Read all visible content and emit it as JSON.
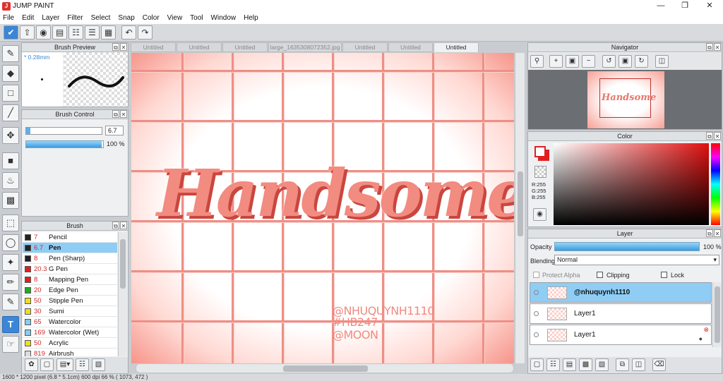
{
  "window": {
    "title": "JUMP PAINT",
    "logo": "jump-paint-logo"
  },
  "menu": [
    "File",
    "Edit",
    "Layer",
    "Filter",
    "Select",
    "Snap",
    "Color",
    "View",
    "Tool",
    "Window",
    "Help"
  ],
  "tabs": [
    "Untitled",
    "Untitled",
    "Untitled",
    "large_1635308072352.jpg",
    "Untitled",
    "Untitled",
    "Untitled"
  ],
  "brush_preview": {
    "title": "Brush Preview",
    "size": "* 0.28mm"
  },
  "brush_control": {
    "title": "Brush Control",
    "size_value": "6.7",
    "opacity_value": "100 %",
    "opacity_level": 1.0,
    "size_level": 0.06
  },
  "brush_panel": {
    "title": "Brush",
    "items": [
      {
        "size": "7",
        "name": "Pencil",
        "color": "#222222"
      },
      {
        "size": "6.7",
        "name": "Pen",
        "color": "#222222",
        "selected": true
      },
      {
        "size": "8",
        "name": "Pen (Sharp)",
        "color": "#222222"
      },
      {
        "size": "20.3",
        "name": "G Pen",
        "color": "#e02020"
      },
      {
        "size": "8",
        "name": "Mapping Pen",
        "color": "#e02020"
      },
      {
        "size": "20",
        "name": "Edge Pen",
        "color": "#22aa22"
      },
      {
        "size": "50",
        "name": "Stipple Pen",
        "color": "#eedd22"
      },
      {
        "size": "30",
        "name": "Sumi",
        "color": "#eedd22"
      },
      {
        "size": "65",
        "name": "Watercolor",
        "color": "#88ccee"
      },
      {
        "size": "169",
        "name": "Watercolor (Wet)",
        "color": "#88ccee"
      },
      {
        "size": "50",
        "name": "Acrylic",
        "color": "#eedd22"
      },
      {
        "size": "819",
        "name": "Airbrush",
        "color": "#dddddd"
      }
    ]
  },
  "canvas": {
    "title_text": "Handsome",
    "credits": [
      "@NHUQUYNH1110",
      "#HB247",
      "@MOON"
    ],
    "colors": {
      "grid": "#ee8f86",
      "text": "#f28b80",
      "shadow": "#c9463f"
    }
  },
  "navigator": {
    "title": "Navigator"
  },
  "color_panel": {
    "title": "Color",
    "r": "R:255",
    "g": "G:255",
    "b": "B:255",
    "foreground": "#e02020"
  },
  "layer_panel": {
    "title": "Layer",
    "opacity_label": "Opacity",
    "opacity_value": "100 %",
    "blending_label": "Blending",
    "blending_value": "Normal",
    "protect_alpha": "Protect Alpha",
    "clipping": "Clipping",
    "lock": "Lock",
    "layers": [
      {
        "name": "@nhuquynh1110",
        "selected": true
      },
      {
        "name": "Layer1",
        "selected": false
      },
      {
        "name": "Layer1",
        "selected": false
      }
    ]
  },
  "status": "1600 * 1200 pixel  (6.8 * 5.1cm)  600 dpi  66 %  ( 1073, 472 )"
}
